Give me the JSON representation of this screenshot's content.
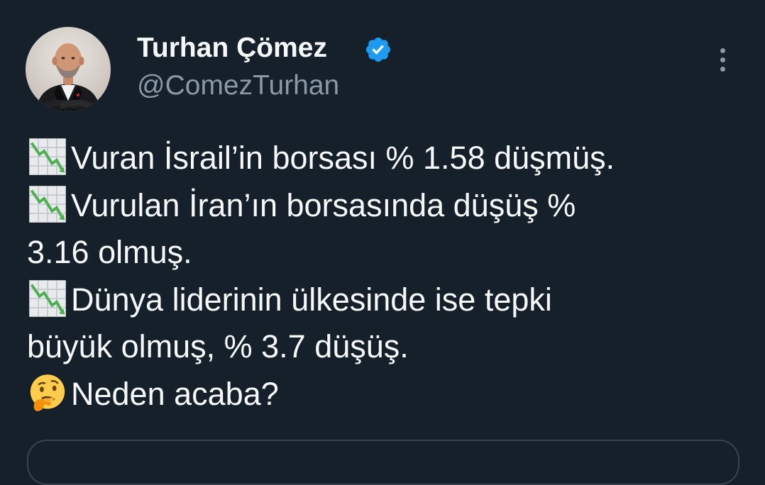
{
  "user": {
    "display_name": "Turhan Çömez",
    "handle": "@ComezTurhan",
    "verified": true,
    "avatar_icon": "profile-photo"
  },
  "icons": {
    "more": "three-dots-vertical-icon",
    "verified": "verified-badge-icon",
    "chart": "chart-decreasing-emoji",
    "thinking": "thinking-face-emoji"
  },
  "tweet": {
    "line1": "Vuran İsrail’in borsası % 1.58 düşmüş.",
    "line2": "Vurulan İran’ın borsasında düşüş %",
    "line3": "3.16 olmuş.",
    "line4": "Dünya liderinin ülkesinde ise tepki",
    "line5": "büyük olmuş, % 3.7 düşüş.",
    "line6": "Neden acaba?"
  },
  "colors": {
    "background": "#15202b",
    "text_primary": "#f7f9f9",
    "text_secondary": "#8b98a5",
    "verified_blue": "#1d9bf0"
  }
}
